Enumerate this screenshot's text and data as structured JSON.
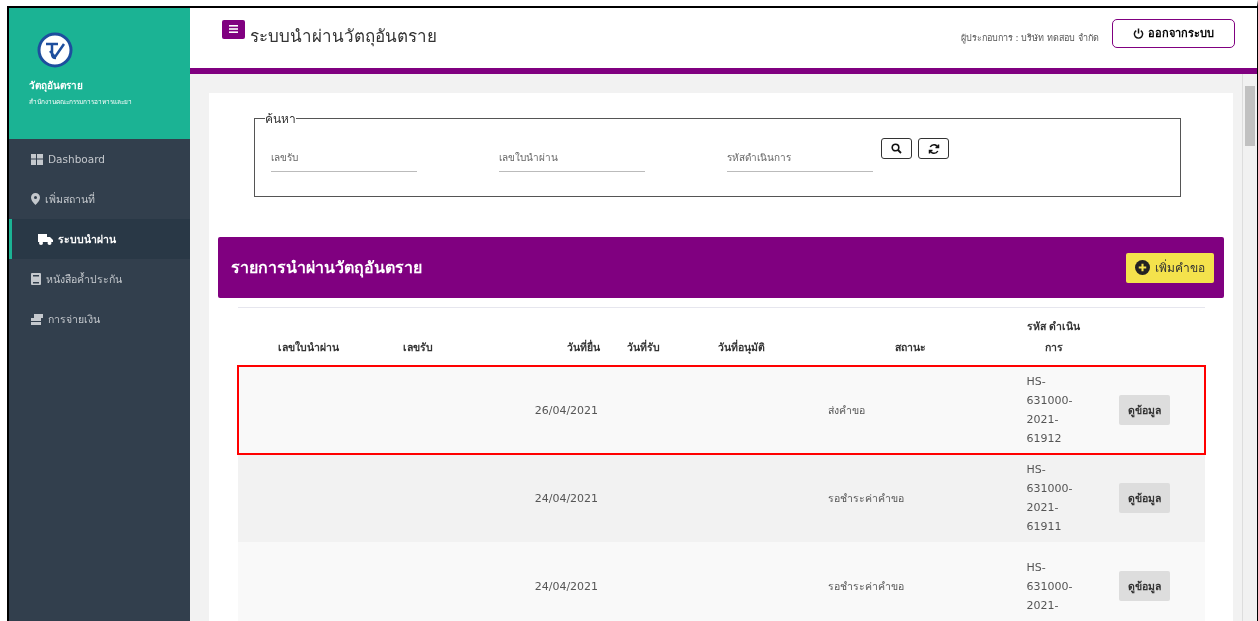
{
  "sidebar": {
    "brand": "วัตถุอันตราย",
    "subtitle": "สำนักงานคณะกรรมการอาหารและยา",
    "items": [
      {
        "label": "Dashboard",
        "kind": "grid",
        "selected": false
      },
      {
        "label": "เพิ่มสถานที่",
        "kind": "pin",
        "selected": false
      },
      {
        "label": "ระบบนำผ่าน",
        "kind": "truck",
        "selected": true
      },
      {
        "label": "หนังสือค้ำประกัน",
        "kind": "book",
        "selected": false
      },
      {
        "label": "การจ่ายเงิน",
        "kind": "money",
        "selected": false
      }
    ]
  },
  "header": {
    "title": "ระบบนำผ่านวัตถุอันตราย",
    "user": "ผู้ประกอบการ : บริษัท ทดสอบ จำกัด",
    "logout": "ออกจากระบบ"
  },
  "search": {
    "legend": "ค้นหา",
    "fields": [
      {
        "placeholder": "เลขรับ"
      },
      {
        "placeholder": "เลขใบนำผ่าน"
      },
      {
        "placeholder": "รหัสดำเนินการ"
      }
    ]
  },
  "list": {
    "title": "รายการนำผ่านวัตถุอันตราย",
    "add_button": "เพิ่มคำขอ"
  },
  "table": {
    "columns": [
      "เลขใบนำผ่าน",
      "เลขรับ",
      "วันที่ยื่น",
      "วันที่รับ",
      "วันที่อนุมัติ",
      "สถานะ",
      "รหัส ดำเนิน การ"
    ],
    "rows": [
      {
        "cells": [
          "",
          "",
          "26/04/2021",
          "",
          "",
          "ส่งคำขอ",
          "HS-631000-2021-61912"
        ],
        "button": "ดูข้อมูล",
        "highlighted": true
      },
      {
        "cells": [
          "",
          "",
          "24/04/2021",
          "",
          "",
          "รอชำระค่าคำขอ",
          "HS-631000-2021-61911"
        ],
        "button": "ดูข้อมูล",
        "highlighted": false
      },
      {
        "cells": [
          "",
          "",
          "24/04/2021",
          "",
          "",
          "รอชำระค่าคำขอ",
          "HS-631000-2021-"
        ],
        "button": "ดูข้อมูล",
        "highlighted": false
      }
    ]
  }
}
